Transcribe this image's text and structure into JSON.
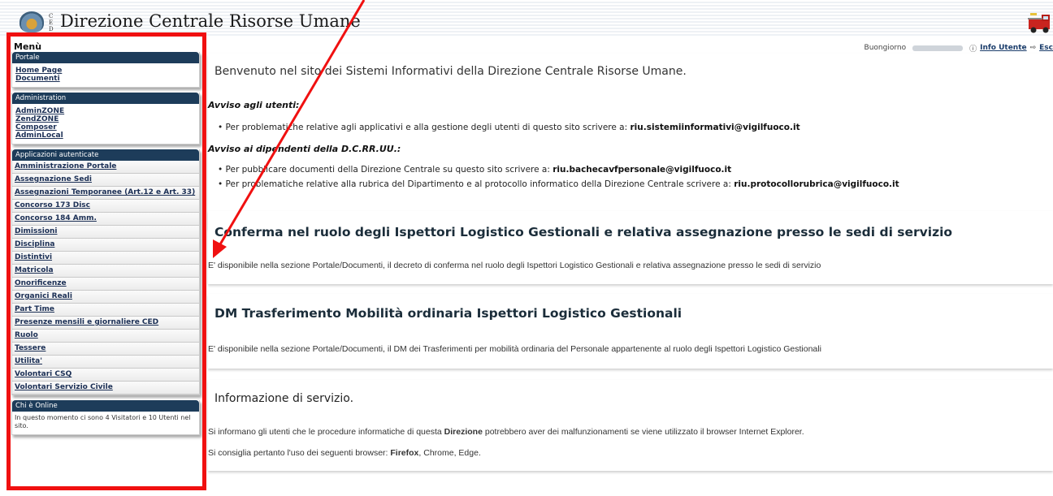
{
  "header": {
    "ced_letters": "C\nE\nD",
    "title": "Direzione Centrale Risorse Umane",
    "greeting": "Buongiorno",
    "info_user_label": "Info Utente",
    "exit_label": "Esc"
  },
  "sidebar": {
    "menu_title": "Menù",
    "portale": {
      "heading": "Portale",
      "items": [
        "Home Page",
        "Documenti"
      ]
    },
    "administration": {
      "heading": "Administration",
      "items": [
        "AdminZONE",
        "ZendZONE",
        "Composer",
        "AdminLocal"
      ]
    },
    "applications": {
      "heading": "Applicazioni autenticate",
      "items": [
        "Amministrazione Portale",
        "Assegnazione Sedi",
        "Assegnazioni Temporanee (Art.12 e Art. 33)",
        "Concorso 173 Disc",
        "Concorso 184 Amm.",
        "Dimissioni",
        "Disciplina",
        "Distintivi",
        "Matricola",
        "Onorificenze",
        "Organici Reali",
        "Part Time",
        "Presenze mensili e giornaliere CED",
        "Ruolo",
        "Tessere",
        "Utilita'",
        "Volontari CSQ",
        "Volontari Servizio Civile"
      ]
    },
    "online": {
      "heading": "Chi è Online",
      "text": "In questo momento ci sono 4 Visitatori e 10 Utenti nel sito."
    }
  },
  "main": {
    "welcome": "Benvenuto nel sito dei Sistemi Informativi della Direzione Centrale Risorse Umane.",
    "notice_users": {
      "heading": "Avviso agli utenti:",
      "bullet_text": "Per problematiche relative agli applicativi e alla gestione degli utenti di questo sito scrivere a: ",
      "bullet_email": "riu.sistemiinformativi@vigilfuoco.it"
    },
    "notice_staff": {
      "heading": "Avviso ai dipendenti della D.C.RR.UU.:",
      "bullet1_text": "Per pubblicare documenti della Direzione Centrale su questo sito scrivere a: ",
      "bullet1_email": "riu.bachecavfpersonale@vigilfuoco.it",
      "bullet2_text": "Per problematiche relative alla rubrica del Dipartimento e al protocollo informatico della Direzione Centrale scrivere a: ",
      "bullet2_email": "riu.protocollorubrica@vigilfuoco.it"
    },
    "news1": {
      "title": "Conferma nel ruolo degli Ispettori Logistico Gestionali e relativa assegnazione presso le sedi di servizio",
      "text": "E' disponibile nella sezione Portale/Documenti, il decreto di conferma nel ruolo degli Ispettori Logistico Gestionali e relativa assegnazione presso le sedi di servizio"
    },
    "news2": {
      "title": "DM Trasferimento Mobilità ordinaria Ispettori Logistico Gestionali",
      "text": "E' disponibile nella sezione Portale/Documenti, il DM dei Trasferimenti per mobilità ordinaria del Personale appartenente al ruolo degli Ispettori Logistico Gestionali"
    },
    "service_info": {
      "title": "Informazione di servizio.",
      "line1_pre": "Si informano gli utenti che le procedure informatiche di questa ",
      "line1_bold": "Direzione",
      "line1_post": " potrebbero aver dei malfunzionamenti se viene utilizzato il browser Internet Explorer.",
      "line2_pre": "Si consiglia pertanto l'uso dei seguenti browser: ",
      "line2_bold": "Firefox",
      "line2_post": ", Chrome, Edge."
    }
  },
  "colors": {
    "box_header": "#1d3c5a",
    "highlight": "#f01010"
  }
}
